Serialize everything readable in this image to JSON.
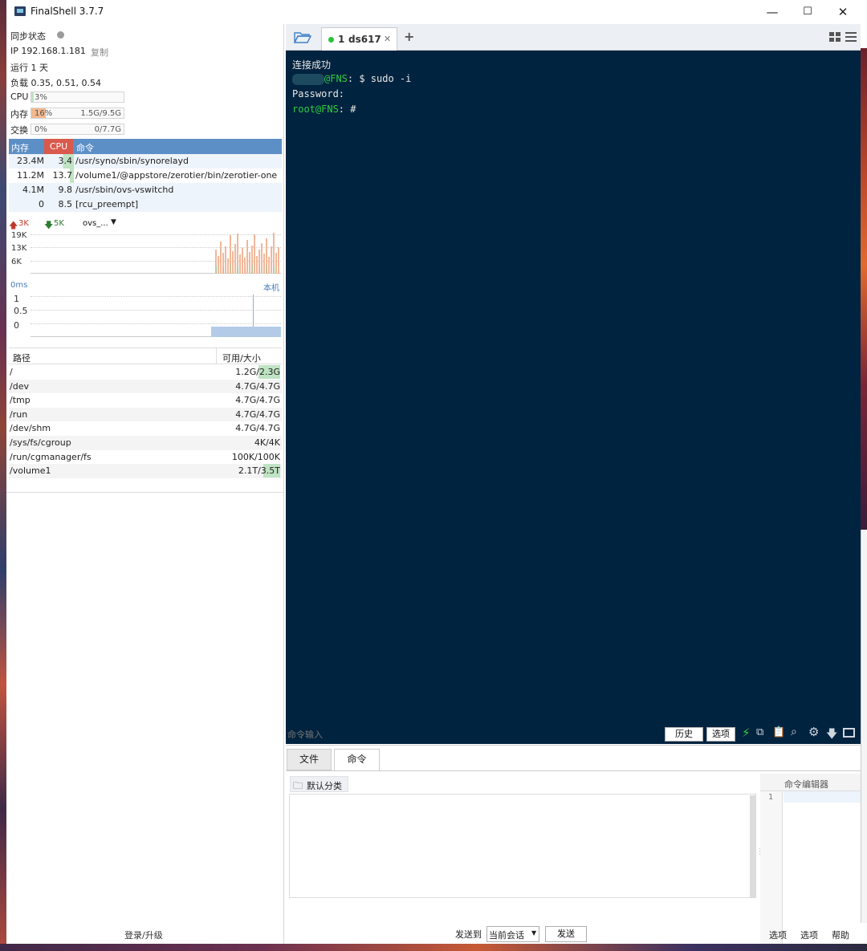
{
  "window": {
    "title": "FinalShell 3.7.7",
    "controls": [
      "—",
      "☐",
      "✕"
    ]
  },
  "sidebar": {
    "sync_label": "同步状态",
    "ip_label": "IP 192.168.1.181",
    "copy_label": "复制",
    "uptime": "运行 1 天",
    "load": "负载 0.35, 0.51, 0.54",
    "cpu": {
      "label": "CPU",
      "percent": "3%",
      "fraction": 0.03
    },
    "mem": {
      "label": "内存",
      "percent": "16%",
      "amount": "1.5G/9.5G",
      "fraction": 0.16
    },
    "swap": {
      "label": "交换",
      "percent": "0%",
      "amount": "0/7.7G",
      "fraction": 0.0
    },
    "proc_headers": {
      "mem": "内存",
      "cpu": "CPU",
      "cmd": "命令"
    },
    "processes": [
      {
        "mem": "23.4M",
        "cpu": "3.4",
        "cmd": "/usr/syno/sbin/synorelayd"
      },
      {
        "mem": "11.2M",
        "cpu": "13.7",
        "cmd": "/volume1/@appstore/zerotier/bin/zerotier-one"
      },
      {
        "mem": "4.1M",
        "cpu": "9.8",
        "cmd": "/usr/sbin/ovs-vswitchd"
      },
      {
        "mem": "0",
        "cpu": "8.5",
        "cmd": "[rcu_preempt]"
      }
    ],
    "net": {
      "up": "3K",
      "down": "5K",
      "iface": "ovs_...",
      "y_labels": [
        "19K",
        "13K",
        "6K"
      ]
    },
    "ping": {
      "latency": "0ms",
      "host": "本机",
      "y_labels": [
        "1",
        "0.5",
        "0"
      ]
    },
    "disk_headers": {
      "path": "路径",
      "size": "可用/大小"
    },
    "disks": [
      {
        "path": "/",
        "size": "1.2G/2.3G",
        "used": 0.48
      },
      {
        "path": "/dev",
        "size": "4.7G/4.7G",
        "used": 0
      },
      {
        "path": "/tmp",
        "size": "4.7G/4.7G",
        "used": 0
      },
      {
        "path": "/run",
        "size": "4.7G/4.7G",
        "used": 0
      },
      {
        "path": "/dev/shm",
        "size": "4.7G/4.7G",
        "used": 0
      },
      {
        "path": "/sys/fs/cgroup",
        "size": "4K/4K",
        "used": 0
      },
      {
        "path": "/run/cgmanager/fs",
        "size": "100K/100K",
        "used": 0
      },
      {
        "path": "/volume1",
        "size": "2.1T/3.5T",
        "used": 0.4
      }
    ],
    "login_label": "登录/升级"
  },
  "tabs": [
    {
      "index": "1",
      "name": "ds617"
    }
  ],
  "terminal": {
    "lines": [
      {
        "text": "连接成功"
      },
      {
        "user_host": "@FNS",
        "suffix": ": $ sudo -i"
      },
      {
        "text": "Password:"
      },
      {
        "user_host": "root@FNS",
        "suffix": ": #"
      }
    ],
    "colors": {
      "bg": "#00233f",
      "prompt": "#2ecc40"
    }
  },
  "cmd_input": {
    "placeholder": "命令输入",
    "history_label": "历史",
    "options_label": "选项"
  },
  "bottom_tabs": [
    {
      "label": "文件"
    },
    {
      "label": "命令"
    }
  ],
  "commands": {
    "category": "默认分类",
    "editor_title": "命令编辑器",
    "editor_line": "1",
    "send_to_label": "发送到",
    "target": "当前会话",
    "send_label": "发送",
    "footer_labels": [
      "选项",
      "选项",
      "帮助"
    ]
  }
}
